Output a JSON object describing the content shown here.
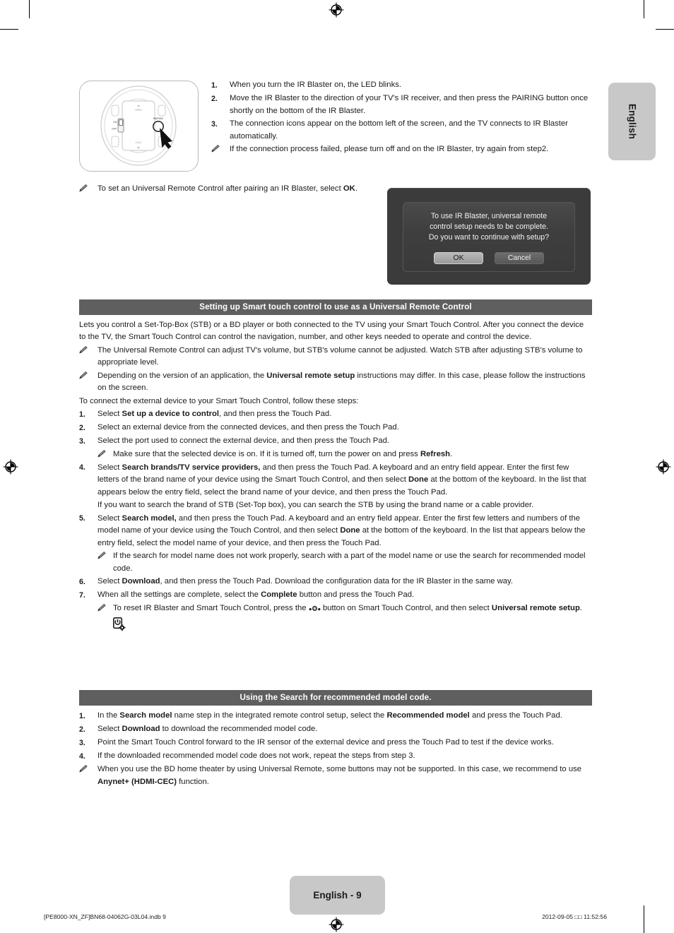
{
  "page": {
    "language_tab": "English",
    "page_label": "English - 9",
    "footer_left": "[PE8000-XN_ZF]BN68-04062G-03L04.indb   9",
    "footer_right": "2012-09-05   □□ 11:52:56",
    "header_bar_color": "#605f5f",
    "tab_color": "#c8c8c8"
  },
  "illustration": {
    "name": "ir-blaster-bottom-view",
    "labels": {
      "switch_on": "ON",
      "switch_off": "OFF",
      "pairing": "PAIRING"
    }
  },
  "top_steps": [
    {
      "num": "1.",
      "text": "When you turn the IR Blaster on, the LED blinks."
    },
    {
      "num": "2.",
      "text": "Move the IR Blaster to the direction of your TV's IR receiver, and then press the PAIRING button once shortly on the bottom of the IR Blaster."
    },
    {
      "num": "3.",
      "text": "The connection icons appear on the bottom left of the screen, and the TV connects to IR Blaster automatically."
    }
  ],
  "top_note": "If the connection process failed, please turn off and on the IR Blaster, try again from step2.",
  "ok_note": {
    "before": "To set an Universal Remote Control after pairing an IR Blaster, select ",
    "bold": "OK",
    "after": "."
  },
  "dialog": {
    "message": "To use IR Blaster, universal remote control setup needs to be complete. Do you want to continue with setup?",
    "line1": "To use IR Blaster, universal remote",
    "line2": "control setup needs to be complete.",
    "line3": "Do you want to continue with setup?",
    "ok_label": "OK",
    "cancel_label": "Cancel"
  },
  "section1": {
    "title": "Setting up Smart touch control to use as a Universal Remote Control",
    "intro": "Lets you control a Set-Top-Box (STB) or a BD player or both connected to the TV using your Smart Touch Control. After you connect the device to the TV, the Smart Touch Control can control the navigation, number, and other keys needed to operate and control the device.",
    "note1": "The Universal Remote Control can adjust TV's volume, but STB's volume cannot be adjusted. Watch STB after adjusting STB's volume to appropriate level.",
    "note2_a": "Depending on the version of an application, the ",
    "note2_b": "Universal remote setup",
    "note2_c": " instructions may differ. In this case, please follow the instructions on the screen.",
    "lead": "To connect the external device to your Smart Touch Control, follow these steps:",
    "steps": [
      {
        "num": "1.",
        "parts": [
          {
            "t": "Select "
          },
          {
            "t": "Set up a device to control",
            "b": true
          },
          {
            "t": ", and then press the Touch Pad."
          }
        ]
      },
      {
        "num": "2.",
        "parts": [
          {
            "t": "Select an external device from the connected devices, and then press the Touch Pad."
          }
        ]
      },
      {
        "num": "3.",
        "parts": [
          {
            "t": "Select the port used to connect the external device, and then press the Touch Pad."
          }
        ]
      },
      {
        "num": "4.",
        "parts": [
          {
            "t": "Select "
          },
          {
            "t": "Search brands/TV service providers,",
            "b": true
          },
          {
            "t": " and then press the Touch Pad. A keyboard and an entry field appear. Enter the first few letters of the brand name of your device using the Smart Touch Control, and then select "
          },
          {
            "t": "Done",
            "b": true
          },
          {
            "t": " at the bottom of the keyboard. In the list that appears below the entry field, select the brand name of your device, and then press the Touch Pad."
          }
        ]
      },
      {
        "num": "5.",
        "parts": [
          {
            "t": "Select "
          },
          {
            "t": "Search model,",
            "b": true
          },
          {
            "t": " and then press the Touch Pad. A keyboard and an entry field appear. Enter the first few letters and numbers of the model name of your device using the Touch Control, and then select "
          },
          {
            "t": "Done",
            "b": true
          },
          {
            "t": " at the bottom of the keyboard. In the list that appears below the entry field, select the model name of your device, and then press the Touch Pad."
          }
        ]
      },
      {
        "num": "6.",
        "parts": [
          {
            "t": "Select "
          },
          {
            "t": "Download",
            "b": true
          },
          {
            "t": ", and then press the Touch Pad. Download the configuration data for the IR Blaster in the same way."
          }
        ]
      },
      {
        "num": "7.",
        "parts": [
          {
            "t": "When all the settings are complete, select the "
          },
          {
            "t": "Complete",
            "b": true
          },
          {
            "t": " button and press the Touch Pad."
          }
        ]
      }
    ],
    "note_step3_a": "Make sure that the selected device is on. If it is turned off, turn the power on and press ",
    "note_step3_b": "Refresh",
    "note_step3_c": ".",
    "note_step4_extra": "If you want to search the brand of STB (Set-Top box), you can search the STB by using the brand name or a cable provider.",
    "note_step5_a": "If the search for model name does not work properly, search with a part of the model name or use the search for recommended model code.",
    "note_step7_a": "To reset IR Blaster and Smart Touch Control, press the ",
    "note_step7_b": " button on Smart Touch Control, and then select ",
    "note_step7_c": "Universal remote setup",
    "note_step7_d": "."
  },
  "section2": {
    "title": "Using the Search for recommended model code.",
    "steps": [
      {
        "num": "1.",
        "parts": [
          {
            "t": "In the "
          },
          {
            "t": "Search model",
            "b": true
          },
          {
            "t": " name step in the integrated remote control setup, select the "
          },
          {
            "t": "Recommended model",
            "b": true
          },
          {
            "t": " and press the Touch Pad."
          }
        ]
      },
      {
        "num": "2.",
        "parts": [
          {
            "t": "Select "
          },
          {
            "t": "Download",
            "b": true
          },
          {
            "t": " to download the recommended model code."
          }
        ]
      },
      {
        "num": "3.",
        "parts": [
          {
            "t": "Point the Smart Touch Control forward to the IR sensor of the external device and press the Touch Pad to test if the device works."
          }
        ]
      },
      {
        "num": "4.",
        "parts": [
          {
            "t": "If the downloaded recommended model code does not work, repeat the steps from step 3."
          }
        ]
      }
    ],
    "note_a": "When you use the BD home theater by using Universal Remote, some buttons may not be supported. In this case, we recommend to use ",
    "note_b": "Anynet+ (HDMI-CEC)",
    "note_c": " function."
  }
}
